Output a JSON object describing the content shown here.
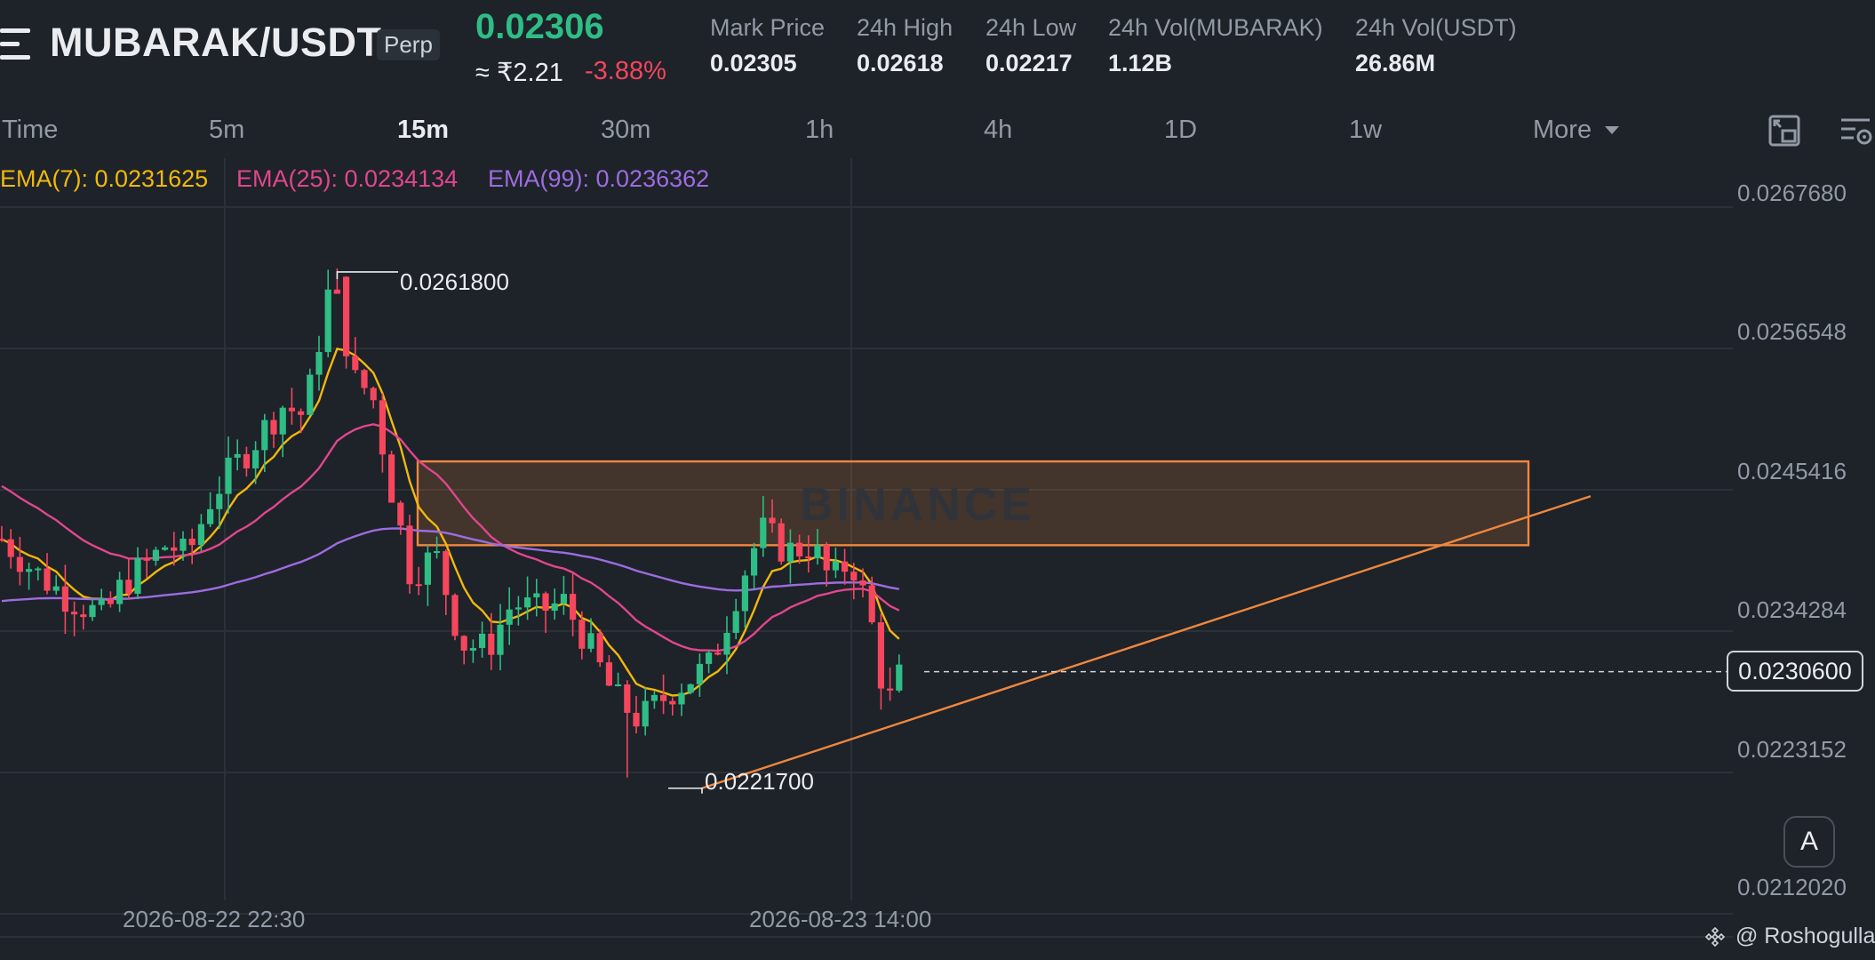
{
  "header": {
    "pair": "MUBARAK/USDT",
    "badge": "Perp",
    "last_price": "0.02306",
    "inr_price": "≈ ₹2.21",
    "change": "-3.88%",
    "stats": [
      {
        "label": "Mark Price",
        "value": "0.02305"
      },
      {
        "label": "24h High",
        "value": "0.02618"
      },
      {
        "label": "24h Low",
        "value": "0.02217"
      },
      {
        "label": "24h Vol(MUBARAK)",
        "value": "1.12B"
      },
      {
        "label": "24h Vol(USDT)",
        "value": "26.86M"
      }
    ]
  },
  "timeframes": {
    "items": [
      "Time",
      "5m",
      "15m",
      "30m",
      "1h",
      "4h",
      "1D",
      "1w",
      "More"
    ],
    "active": "15m",
    "more_icon": "caret-down-icon"
  },
  "toolbar": {
    "icons": [
      "fullscreen-icon",
      "chart-settings-icon"
    ]
  },
  "ema": [
    {
      "label": "EMA(7): 0.0231625",
      "color": "#f0b90b"
    },
    {
      "label": "EMA(25): 0.0234134",
      "color": "#e0468e"
    },
    {
      "label": "EMA(99): 0.0236362",
      "color": "#9d6ce0"
    }
  ],
  "price_axis": [
    "0.0267680",
    "0.0256548",
    "0.0245416",
    "0.0234284",
    "0.0223152",
    "0.0212020"
  ],
  "current_price_tag": "0.0230600",
  "markers": {
    "high": "0.0261800",
    "low": "0.0221700"
  },
  "dates": [
    "2026-08-22 22:30",
    "2026-08-23 14:00"
  ],
  "watermark": "BINANCE",
  "auto_button": "A",
  "credit": "@ Roshogulla",
  "colors": {
    "up": "#2ebd85",
    "down": "#f6465d",
    "background": "#1e2229",
    "drawing": "#f0883e"
  },
  "chart_data": {
    "type": "candlestick",
    "interval": "15m",
    "ylim": [
      0.021202,
      0.026768
    ],
    "y_ticks": [
      0.026768,
      0.0256548,
      0.0245416,
      0.0234284,
      0.0223152,
      0.021202
    ],
    "x_ticks": [
      "2026-08-22 22:30",
      "2026-08-23 14:00"
    ],
    "last_price": 0.02306,
    "annotations": {
      "high_marker": 0.02618,
      "low_marker": 0.02217,
      "zone": {
        "from": 0.024,
        "to": 0.02466
      },
      "trendline": {
        "from": 0.02217,
        "to": 0.02419
      }
    },
    "ema_last": {
      "ema7": 0.0231625,
      "ema25": 0.0234134,
      "ema99": 0.0236362
    }
  }
}
